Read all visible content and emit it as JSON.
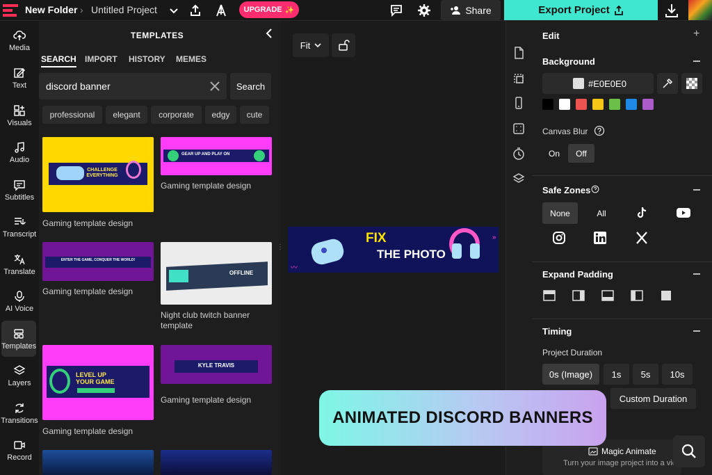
{
  "topbar": {
    "folder": "New Folder",
    "project": "Untitled Project",
    "upgrade": "UPGRADE",
    "share": "Share",
    "export": "Export Project"
  },
  "nav": [
    {
      "label": "Media",
      "icon": "upload-cloud-icon"
    },
    {
      "label": "Text",
      "icon": "text-icon"
    },
    {
      "label": "Visuals",
      "icon": "shapes-icon"
    },
    {
      "label": "Audio",
      "icon": "music-note-icon"
    },
    {
      "label": "Subtitles",
      "icon": "subtitles-icon"
    },
    {
      "label": "Transcript",
      "icon": "transcript-icon"
    },
    {
      "label": "Translate",
      "icon": "translate-icon"
    },
    {
      "label": "AI Voice",
      "icon": "microphone-icon"
    },
    {
      "label": "Templates",
      "icon": "templates-icon"
    },
    {
      "label": "Layers",
      "icon": "layers-icon"
    },
    {
      "label": "Transitions",
      "icon": "transitions-icon"
    },
    {
      "label": "Record",
      "icon": "record-icon"
    }
  ],
  "templates": {
    "title": "TEMPLATES",
    "tabs": [
      "SEARCH",
      "IMPORT",
      "HISTORY",
      "MEMES"
    ],
    "search_value": "discord banner",
    "search_button": "Search",
    "chips": [
      "professional",
      "elegant",
      "corporate",
      "edgy",
      "cute"
    ],
    "items": [
      {
        "caption": "Gaming template design",
        "thumb_text": "CHALLENGE EVERYTHING"
      },
      {
        "caption": "Gaming template design",
        "thumb_text": "GEAR UP AND PLAY ON"
      },
      {
        "caption": "Gaming template design",
        "thumb_text": "ENTER THE GAME, CONQUER THE WORLD!"
      },
      {
        "caption": "Night club twitch banner template",
        "thumb_text": "OFFLINE"
      },
      {
        "caption": "Gaming template design",
        "thumb_text": "LEVEL UP YOUR GAME"
      },
      {
        "caption": "Gaming template design",
        "thumb_text": "KYLE TRAVIS"
      }
    ]
  },
  "canvas": {
    "fit": "Fit",
    "banner_line1": "FIX",
    "banner_line2": "THE PHOTO"
  },
  "right": {
    "edit": "Edit",
    "background": "Background",
    "bg_hex": "#E0E0E0",
    "swatches": [
      "#000000",
      "#ffffff",
      "#ef5350",
      "#f5c518",
      "#6cc04a",
      "#1e88e5",
      "#ab5cc9"
    ],
    "canvas_blur": "Canvas Blur",
    "on": "On",
    "off": "Off",
    "safe_zones": "Safe Zones",
    "none": "None",
    "all": "All",
    "expand_padding": "Expand Padding",
    "timing": "Timing",
    "project_duration": "Project Duration",
    "durations": [
      "0s (Image)",
      "1s",
      "5s",
      "10s"
    ],
    "custom_duration": "Custom Duration",
    "magic_animate": "Magic Animate",
    "magic_sub": "Turn your image project into a video"
  },
  "promo": "ANIMATED DISCORD BANNERS"
}
